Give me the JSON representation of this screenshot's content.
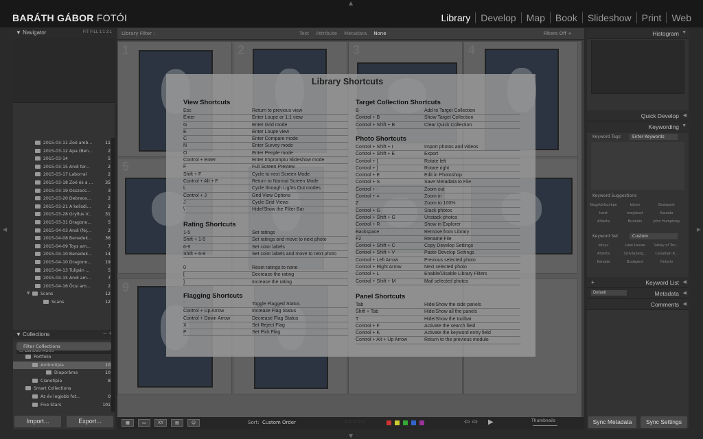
{
  "brand": {
    "name": "BARÁTH GÁBOR",
    "suffix": " FOTÓI"
  },
  "modules": [
    "Library",
    "Develop",
    "Map",
    "Book",
    "Slideshow",
    "Print",
    "Web"
  ],
  "navigator": {
    "title": "Navigator",
    "zoom": "FIT  FILL  1:1  3:1"
  },
  "folders": [
    {
      "name": "2015-03-11 Zoé amb...",
      "count": "11"
    },
    {
      "name": "2015-03-12 Apa (Ben...",
      "count": "2"
    },
    {
      "name": "2015-03-14",
      "count": "5"
    },
    {
      "name": "2015-03-15 Andi tor...",
      "count": "2"
    },
    {
      "name": "2015-03-17 Laborral",
      "count": "2"
    },
    {
      "name": "2015-03-18 Zoé és a ...",
      "count": "35"
    },
    {
      "name": "2015-03-19 Osszecs...",
      "count": "3"
    },
    {
      "name": "2015-03-20 Debrece...",
      "count": "2"
    },
    {
      "name": "2015-03-21 A kolisdi...",
      "count": "2"
    },
    {
      "name": "2015-03-28 Gryllus V...",
      "count": "31"
    },
    {
      "name": "2015-03-31 Dragono...",
      "count": "5"
    },
    {
      "name": "2015-04-03 Andi (fej...",
      "count": "2"
    },
    {
      "name": "2015-04-08 Benedek...",
      "count": "36"
    },
    {
      "name": "2015-04-09 Toys am...",
      "count": "7"
    },
    {
      "name": "2015-04-10 Benedek...",
      "count": "14"
    },
    {
      "name": "2015-04-10 Dragono...",
      "count": "19"
    },
    {
      "name": "2015-04-13 Tulipán ...",
      "count": "5"
    },
    {
      "name": "2015-04-15 Andi am...",
      "count": "7"
    },
    {
      "name": "2015-04-16 Öcsi am...",
      "count": "2"
    },
    {
      "name": "Scans",
      "count": "12"
    },
    {
      "name": "Scans",
      "count": "12"
    }
  ],
  "device": "Lenovo A606",
  "collections": {
    "title": "Collections",
    "filter": "Filter Collections",
    "items": [
      {
        "name": "Portfolio",
        "count": ""
      },
      {
        "name": "Ambrotípia",
        "count": "10"
      },
      {
        "name": "Diaporáma",
        "count": "10"
      },
      {
        "name": "Cianotípia",
        "count": "8"
      },
      {
        "name": "Smart Collections",
        "count": ""
      },
      {
        "name": "Az év legjobb fot...",
        "count": "0"
      },
      {
        "name": "Five Stars",
        "count": "101"
      }
    ]
  },
  "buttons": {
    "import": "Import...",
    "export": "Export...",
    "sync_meta": "Sync Metadata",
    "sync_set": "Sync Settings"
  },
  "filterbar": {
    "label": "Library Filter :",
    "opts": [
      "Text",
      "Attribute",
      "Metadata",
      "None"
    ],
    "off": "Filters Off ÷"
  },
  "toolbar": {
    "sort_label": "Sort:",
    "sort_value": "Custom Order",
    "thumbs": "Thumbnails"
  },
  "grid_numbers": [
    "1",
    "2",
    "3",
    "4",
    "5",
    "6",
    "7",
    "8",
    "9",
    "10",
    "11",
    "12"
  ],
  "shortcuts": {
    "title": "Library Shortcuts",
    "view": {
      "title": "View Shortcuts",
      "rows": [
        [
          "Esc",
          "Return to previous view"
        ],
        [
          "Enter",
          "Enter Loupe or 1:1 view"
        ],
        [
          "G",
          "Enter Grid mode"
        ],
        [
          "E",
          "Enter Loupe view"
        ],
        [
          "C",
          "Enter Compare mode"
        ],
        [
          "N",
          "Enter Survey mode"
        ],
        [
          "O",
          "Enter People mode"
        ],
        [
          "Control + Enter",
          "Enter Impromptu Slideshow mode"
        ],
        [
          "F",
          "Full Screen Preview"
        ],
        [
          "Shift + F",
          "Cycle to next Screen Mode"
        ],
        [
          "Control + Alt + F",
          "Return to Normal Screen Mode"
        ],
        [
          "L",
          "Cycle through Lights Out modes"
        ],
        [
          "Control + J",
          "Grid View Options"
        ],
        [
          "J",
          "Cycle Grid Views"
        ],
        [
          "\\",
          "Hide/Show the Filter Bar"
        ]
      ]
    },
    "rating": {
      "title": "Rating Shortcuts",
      "rows": [
        [
          "1-5",
          "Set ratings"
        ],
        [
          "Shift + 1-5",
          "Set ratings and move to next photo"
        ],
        [
          "6-9",
          "Set color labels"
        ],
        [
          "Shift + 6-9",
          "Set color labels and move to next photo"
        ],
        [
          "0",
          "Reset ratings to none"
        ],
        [
          "[",
          "Decrease the rating"
        ],
        [
          "]",
          "Increase the rating"
        ]
      ]
    },
    "flag": {
      "title": "Flagging Shortcuts",
      "rows": [
        [
          "`",
          "Toggle Flagged Status"
        ],
        [
          "Control + Up Arrow",
          "Increase Flag Status"
        ],
        [
          "Control + Down Arrow",
          "Decrease Flag Status"
        ],
        [
          "X",
          "Set Reject Flag"
        ],
        [
          "P",
          "Set Pick Flag"
        ]
      ]
    },
    "target": {
      "title": "Target Collection Shortcuts",
      "rows": [
        [
          "B",
          "Add to Target Collection"
        ],
        [
          "Control + B",
          "Show Target Collection"
        ],
        [
          "Control + Shift + B",
          "Clear Quick Collection"
        ]
      ]
    },
    "photo": {
      "title": "Photo Shortcuts",
      "rows": [
        [
          "Control + Shift + I",
          "Import photos and videos"
        ],
        [
          "Control + Shift + E",
          "Export"
        ],
        [
          "Control + [",
          "Rotate left"
        ],
        [
          "Control + ]",
          "Rotate right"
        ],
        [
          "Control + E",
          "Edit in Photoshop"
        ],
        [
          "Control + S",
          "Save Metadata to File"
        ],
        [
          "Control + -",
          "Zoom out"
        ],
        [
          "Control + =",
          "Zoom in"
        ],
        [
          "Z",
          "Zoom to 100%"
        ],
        [
          "Control + G",
          "Stack photos"
        ],
        [
          "Control + Shift + G",
          "Unstack photos"
        ],
        [
          "Control + R",
          "Show in Explorer"
        ],
        [
          "Backspace",
          "Remove from Library"
        ],
        [
          "F2",
          "Rename File"
        ],
        [
          "Control + Shift + C",
          "Copy Develop Settings"
        ],
        [
          "Control + Shift + V",
          "Paste Develop Settings"
        ],
        [
          "Control + Left Arrow",
          "Previous selected photo"
        ],
        [
          "Control + Right Arrow",
          "Next selected photo"
        ],
        [
          "Control + L",
          "Enable/Disable Library Filters"
        ],
        [
          "Control + Shift + M",
          "Mail selected photos"
        ]
      ]
    },
    "panel": {
      "title": "Panel Shortcuts",
      "rows": [
        [
          "Tab",
          "Hide/Show the side panels"
        ],
        [
          "Shift + Tab",
          "Hide/Show all the panels"
        ],
        [
          "T",
          "Hide/Show the toolbar"
        ],
        [
          "Control + F",
          "Activate the search field"
        ],
        [
          "Control + K",
          "Activate the keyword entry field"
        ],
        [
          "Control + Alt + Up Arrow",
          "Return to the previous module"
        ]
      ]
    }
  },
  "right": {
    "histogram": "Histogram",
    "quick_develop": "Quick Develop",
    "keywording": "Keywording",
    "kw_tags": "Keyword Tags",
    "kw_tags_val": "Enter Keywords",
    "kw_sugg": "Keyword Suggestions",
    "sugg": [
      "Nagykörbunkpe",
      "könyv",
      "Budapest",
      "teszt",
      "megteszt",
      "Kanada",
      "Alberta",
      "Budaörs",
      "John Humphrey"
    ],
    "kw_set": "Keyword Set",
    "kw_set_val": "Custom",
    "set": [
      "könyv",
      "Lake Louise",
      "Valley of Ten...",
      "Alberta",
      "Szilvásberg...",
      "Canadian R...",
      "Kanada",
      "Budapest",
      "Ontario"
    ],
    "kw_list": "Keyword List",
    "metadata": "Metadata",
    "meta_preset": "Default",
    "comments": "Comments"
  }
}
